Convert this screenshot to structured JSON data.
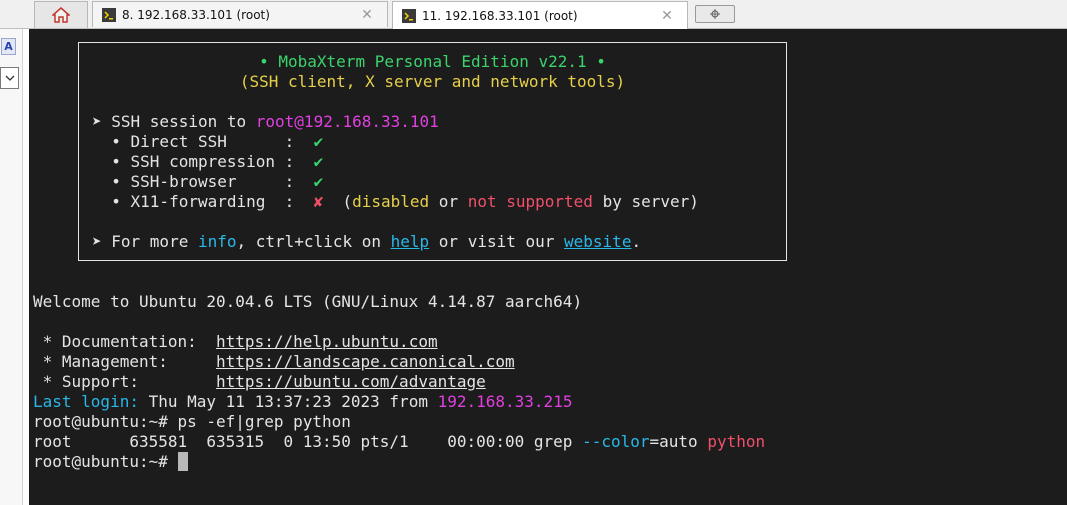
{
  "tabs": [
    {
      "label": "8. 192.168.33.101 (root)",
      "close": "✕"
    },
    {
      "label": "11. 192.168.33.101 (root)",
      "close": "✕"
    }
  ],
  "icons": {
    "home": "home-icon",
    "terminal": "terminal-icon",
    "new_tab": "new-tab-icon"
  },
  "left_panel": {
    "a_label": "A"
  },
  "banner": {
    "title": "• MobaXterm Personal Edition v22.1 •",
    "subtitle": "(SSH client, X server and network tools)",
    "session_prefix": "➤ SSH session to ",
    "session_target": "root@192.168.33.101",
    "features": [
      {
        "label": "  • Direct SSH      :  ",
        "mark": "✔"
      },
      {
        "label": "  • SSH compression :  ",
        "mark": "✔"
      },
      {
        "label": "  • SSH-browser     :  ",
        "mark": "✔"
      }
    ],
    "x11": {
      "label": "  • X11-forwarding  :  ",
      "mark": "✘",
      "open": "  (",
      "disabled": "disabled",
      "or": " or ",
      "not_supported": "not supported",
      "by_server": " by server)"
    },
    "more": {
      "prefix": "➤ For more ",
      "info": "info",
      "mid1": ", ctrl+click on ",
      "help": "help",
      "mid2": " or visit our ",
      "website": "website",
      "end": "."
    }
  },
  "terminal": {
    "welcome": "Welcome to Ubuntu 20.04.6 LTS (GNU/Linux 4.14.87 aarch64)",
    "links": [
      {
        "label": " * Documentation:  ",
        "url": "https://help.ubuntu.com"
      },
      {
        "label": " * Management:     ",
        "url": "https://landscape.canonical.com"
      },
      {
        "label": " * Support:        ",
        "url": "https://ubuntu.com/advantage"
      }
    ],
    "last_login_label": "Last login:",
    "last_login_text": " Thu May 11 13:37:23 2023 from ",
    "last_login_ip": "192.168.33.215",
    "prompt1": "root@ubuntu:~# ",
    "command": "ps -ef|grep python",
    "ps_output": "root      635581  635315  0 13:50 pts/1    00:00:00 grep ",
    "ps_flag": "--color",
    "ps_eq": "=auto ",
    "ps_match": "python",
    "prompt2": "root@ubuntu:~# "
  },
  "colors": {
    "terminal_bg": "#1c1c1c",
    "green": "#3ad46c",
    "yellow": "#e6d04a",
    "magenta": "#e040e0",
    "red": "#f0506a",
    "cyan": "#28b8e8"
  }
}
